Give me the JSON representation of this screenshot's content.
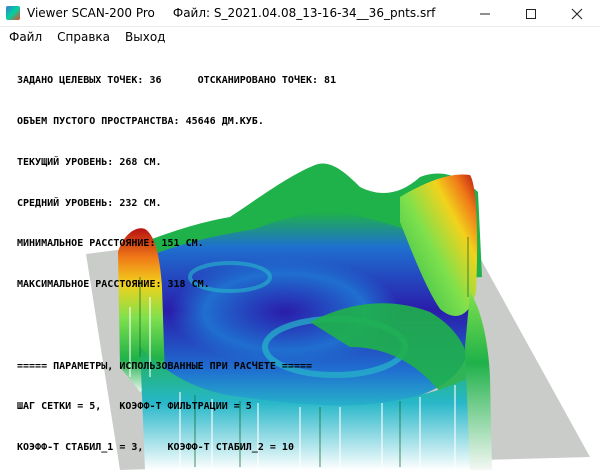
{
  "window": {
    "app_title": "Viewer SCAN-200 Pro",
    "file_title": "Файл: S_2021.04.08_13-16-34__36_pnts.srf",
    "minimize_icon": "minimize-icon",
    "maximize_icon": "maximize-icon",
    "close_icon": "close-icon"
  },
  "menu": {
    "file": "Файл",
    "help": "Справка",
    "exit": "Выход"
  },
  "info": {
    "line1_a": "ЗАДАНО ЦЕЛЕВЫХ ТОЧЕК: 36",
    "line1_b": "ОТСКАНИРОВАНО ТОЧЕК: 81",
    "volume": "ОБЪЕМ ПУСТОГО ПРОСТРАНСТВА: 45646 ДМ.КУБ.",
    "current_level": "ТЕКУЩИЙ УРОВЕНЬ: 268 СМ.",
    "avg_level": "СРЕДНИЙ УРОВЕНЬ: 232 СМ.",
    "min_distance": "МИНИМАЛЬНОЕ РАССТОЯНИЕ: 151 СМ.",
    "max_distance": "МАКСИМАЛЬНОЕ РАССТОЯНИЕ: 318 СМ.",
    "params_header": "===== ПАРАМЕТРЫ, ИСПОЛЬЗОВАННЫЕ ПРИ РАСЧЕТЕ =====",
    "grid_step": "ШАГ СЕТКИ = 5,",
    "filter_coef": "КОЭФФ-Т ФИЛЬТРАЦИИ = 5",
    "stab1": "КОЭФФ-Т СТАБИЛ_1 = 3,",
    "stab2": "КОЭФФ-Т СТАБИЛ_2 = 10"
  },
  "colors": {
    "low": "#2a1cab",
    "mid_blue": "#1f6fd0",
    "cyan": "#27b7c9",
    "green": "#1fb14a",
    "light_green": "#7ee04c",
    "yellow": "#f2d21c",
    "orange": "#f07a18",
    "high": "#b81212",
    "floor": "#c9ccc9"
  }
}
